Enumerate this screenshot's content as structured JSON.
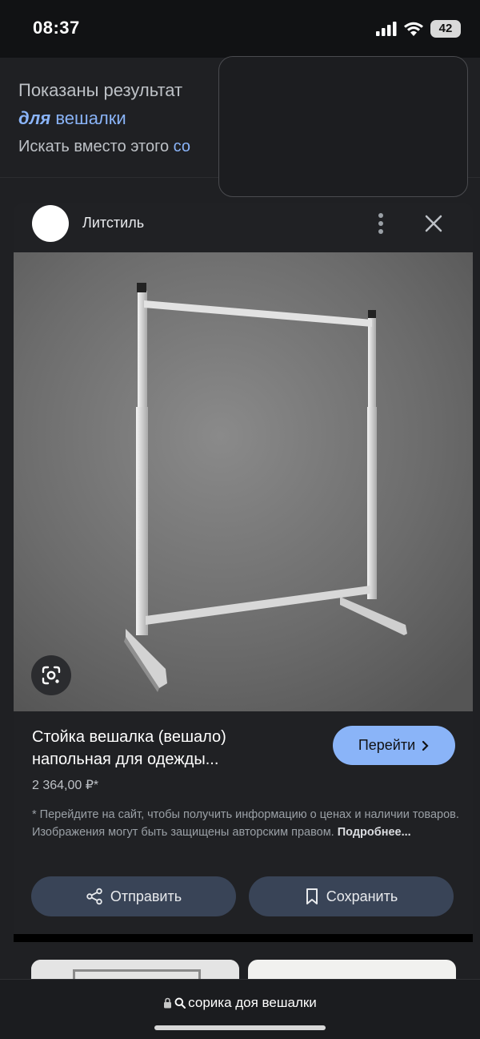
{
  "status_bar": {
    "time": "08:37",
    "battery": "42",
    "icons": [
      "signal-icon",
      "wifi-icon",
      "battery-icon"
    ]
  },
  "results": {
    "shown_text": "Показаны результат",
    "query_bold": "для",
    "query_rest": " вешалки",
    "instead_text": "Искать вместо этого ",
    "instead_link": "со"
  },
  "card": {
    "site_name": "Литстиль",
    "title": "Стойка вешалка (вешало) напольная для одежды...",
    "go_label": "Перейти",
    "price": "2 364,00 ₽*",
    "disclaimer": "* Перейдите на сайт, чтобы получить информацию о ценах и наличии товаров. Изображения могут быть защищены авторским правом. ",
    "more_link": "Подробнее...",
    "send_label": "Отправить",
    "save_label": "Сохранить"
  },
  "bottom_bar": {
    "url": "сорика доя вешалки"
  },
  "colors": {
    "background": "#1f2023",
    "accent": "#8ab4f8",
    "action_button": "#394457"
  }
}
